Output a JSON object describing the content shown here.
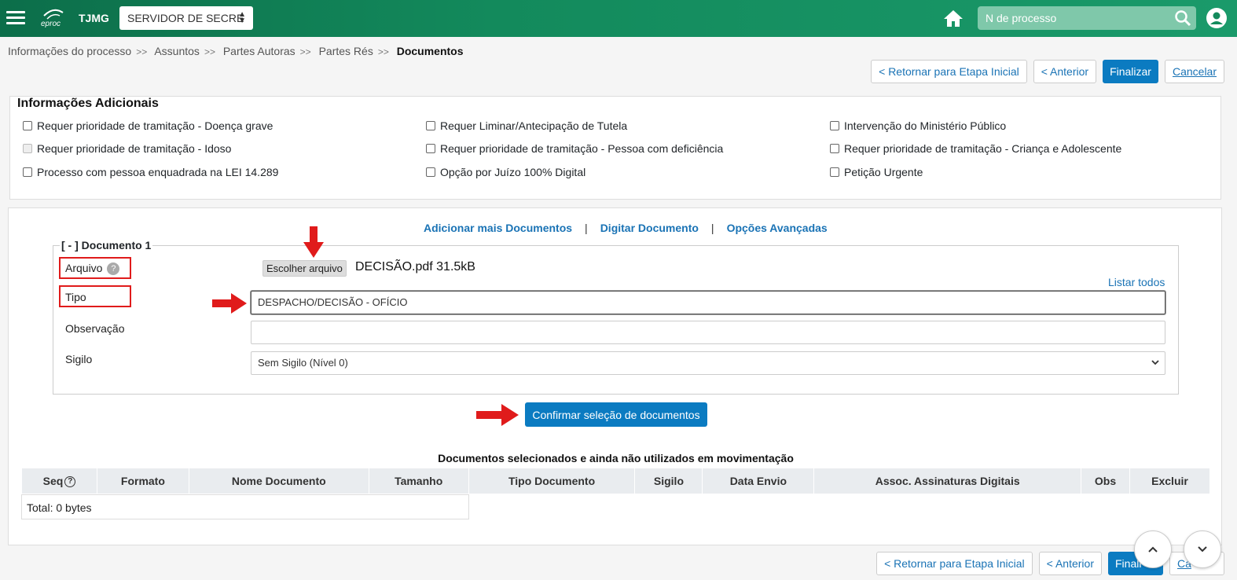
{
  "header": {
    "brand": "TJMG",
    "logo_text": "eproc",
    "server_select": "SERVIDOR DE SECRE",
    "search_placeholder": "N de processo"
  },
  "breadcrumb": {
    "items": [
      "Informações do processo",
      "Assuntos",
      "Partes Autoras",
      "Partes Rés"
    ],
    "current": "Documentos",
    "separator": ">>"
  },
  "nav": {
    "back_initial": "< Retornar para Etapa Inicial",
    "previous": "< Anterior",
    "finish": "Finalizar",
    "cancel": "Cancelar",
    "finish_partial": "Finali",
    "cancel_partial": "Ca"
  },
  "info": {
    "title": "Informações Adicionais",
    "options": [
      "Requer prioridade de tramitação - Doença grave",
      "Requer Liminar/Antecipação de Tutela",
      "Intervenção do Ministério Público",
      "Requer prioridade de tramitação - Idoso",
      "Requer prioridade de tramitação - Pessoa com deficiência",
      "Requer prioridade de tramitação - Criança e Adolescente",
      "Processo com pessoa enquadrada na LEI 14.289",
      "Opção por Juízo 100% Digital",
      "Petição Urgente"
    ]
  },
  "docs": {
    "links": [
      "Adicionar mais Documentos",
      "Digitar Documento",
      "Opções Avançadas"
    ],
    "legend": "[ - ] Documento 1",
    "arquivo_label": "Arquivo",
    "help": "?",
    "file_button": "Escolher arquivo",
    "file_name": "DECISÃO.pdf 31.5kB",
    "listar_todos": "Listar todos",
    "tipo_label": "Tipo",
    "tipo_value": "DESPACHO/DECISÃO - OFÍCIO",
    "observacao_label": "Observação",
    "observacao_value": "",
    "sigilo_label": "Sigilo",
    "sigilo_value": "Sem Sigilo (Nível 0)",
    "confirm_button": "Confirmar seleção de documentos"
  },
  "table": {
    "caption": "Documentos selecionados e ainda não utilizados em movimentação",
    "columns": [
      "Seq",
      "Formato",
      "Nome Documento",
      "Tamanho",
      "Tipo Documento",
      "Sigilo",
      "Data Envio",
      "Assoc. Assinaturas Digitais",
      "Obs",
      "Excluir"
    ],
    "total": "Total: 0 bytes"
  },
  "colors": {
    "header_green": "#138a5c",
    "primary_blue": "#0b7bc1",
    "link_blue": "#1a73b5",
    "annotation_red": "#e01b1b"
  }
}
